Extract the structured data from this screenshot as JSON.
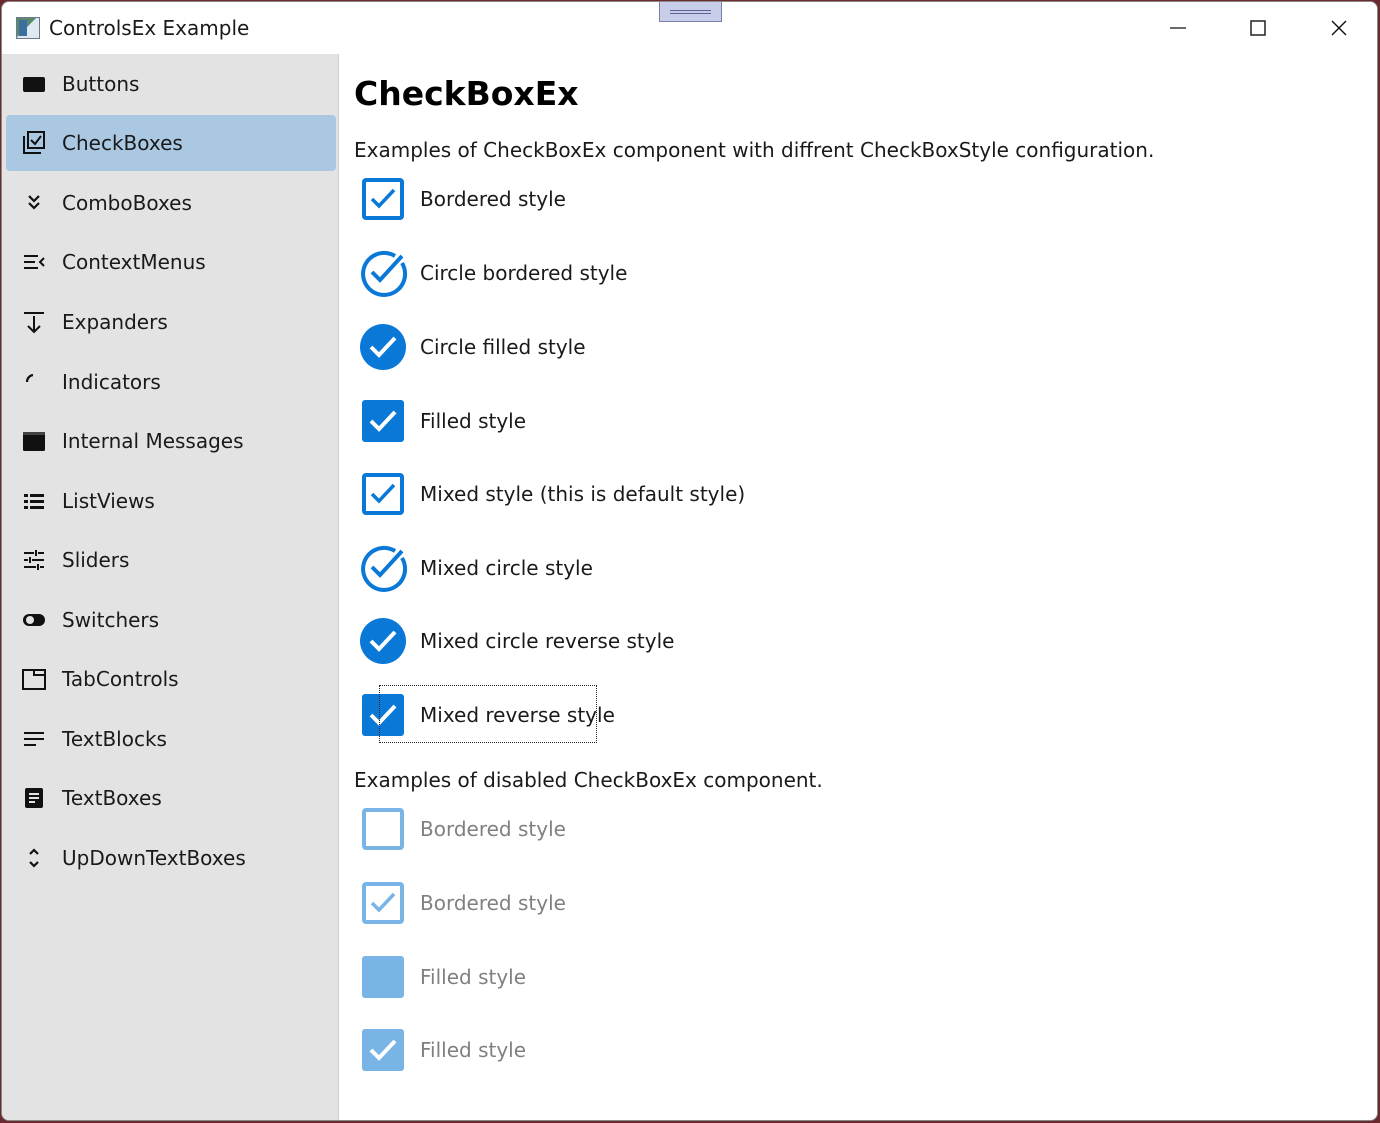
{
  "window": {
    "title": "ControlsEx Example"
  },
  "colors": {
    "accent": "#0a78d7",
    "disabled_accent": "#78b4e6",
    "sidebar_bg": "#e3e3e3",
    "sidebar_selected": "#abc8e3"
  },
  "sidebar": {
    "items": [
      {
        "label": "Buttons",
        "icon": "button-icon"
      },
      {
        "label": "CheckBoxes",
        "icon": "checkbox-list-icon",
        "selected": true
      },
      {
        "label": "ComboBoxes",
        "icon": "double-chevron-down-icon"
      },
      {
        "label": "ContextMenus",
        "icon": "menu-open-icon"
      },
      {
        "label": "Expanders",
        "icon": "arrow-down-bar-icon"
      },
      {
        "label": "Indicators",
        "icon": "arc-icon"
      },
      {
        "label": "Internal Messages",
        "icon": "message-window-icon"
      },
      {
        "label": "ListViews",
        "icon": "list-icon"
      },
      {
        "label": "Sliders",
        "icon": "sliders-icon"
      },
      {
        "label": "Switchers",
        "icon": "toggle-icon"
      },
      {
        "label": "TabControls",
        "icon": "tab-icon"
      },
      {
        "label": "TextBlocks",
        "icon": "text-lines-icon"
      },
      {
        "label": "TextBoxes",
        "icon": "textbox-icon"
      },
      {
        "label": "UpDownTextBoxes",
        "icon": "updown-icon"
      }
    ]
  },
  "main": {
    "title": "CheckBoxEx",
    "enabled_desc": "Examples of CheckBoxEx component with diffrent CheckBoxStyle configuration.",
    "disabled_desc": "Examples of disabled CheckBoxEx component.",
    "enabled_checkboxes": [
      {
        "label": "Bordered style",
        "style": "bordered",
        "checked": true
      },
      {
        "label": "Circle bordered style",
        "style": "circle-bordered",
        "checked": true
      },
      {
        "label": "Circle filled style",
        "style": "circle-filled",
        "checked": true
      },
      {
        "label": "Filled style",
        "style": "filled",
        "checked": true
      },
      {
        "label": "Mixed style (this is default style)",
        "style": "bordered",
        "checked": true
      },
      {
        "label": "Mixed circle style",
        "style": "circle-bordered",
        "checked": true
      },
      {
        "label": "Mixed circle reverse style",
        "style": "circle-filled",
        "checked": true
      },
      {
        "label": "Mixed reverse style",
        "style": "filled",
        "checked": true,
        "focused": true
      }
    ],
    "disabled_checkboxes": [
      {
        "label": "Bordered style",
        "style": "bordered",
        "checked": false
      },
      {
        "label": "Bordered style",
        "style": "bordered",
        "checked": true
      },
      {
        "label": "Filled style",
        "style": "filled",
        "checked": false
      },
      {
        "label": "Filled style",
        "style": "filled",
        "checked": true
      }
    ]
  }
}
